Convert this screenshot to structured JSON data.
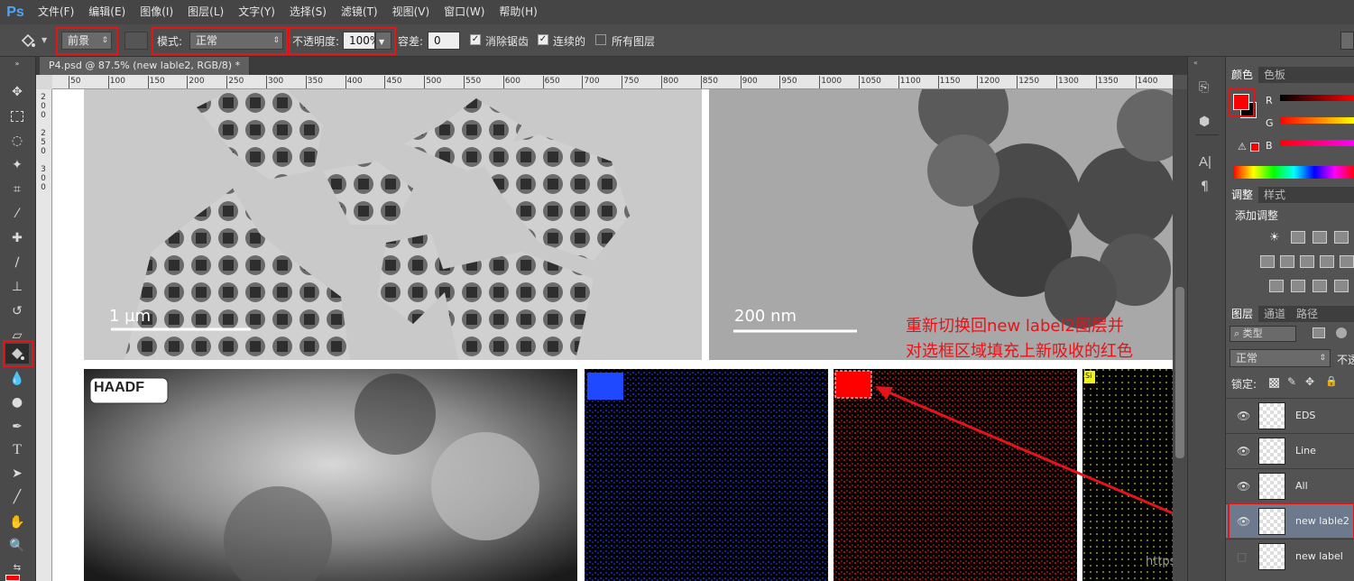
{
  "app": {
    "logo": "Ps"
  },
  "menu": [
    "文件(F)",
    "编辑(E)",
    "图像(I)",
    "图层(L)",
    "文字(Y)",
    "选择(S)",
    "滤镜(T)",
    "视图(V)",
    "窗口(W)",
    "帮助(H)"
  ],
  "options": {
    "fill_source": "前景",
    "mode_label": "模式:",
    "mode_value": "正常",
    "opacity_label": "不透明度:",
    "opacity_value": "100%",
    "tolerance_label": "容差:",
    "tolerance_value": "0",
    "antialias_label": "消除锯齿",
    "contiguous_label": "连续的",
    "all_layers_label": "所有图层"
  },
  "document": {
    "tab_title": "P4.psd @ 87.5% (new lable2, RGB/8) *"
  },
  "ruler_h": [
    "50",
    "100",
    "150",
    "200",
    "250",
    "300",
    "350",
    "400",
    "450",
    "500",
    "550",
    "600",
    "650",
    "700",
    "750",
    "800",
    "850",
    "900",
    "950",
    "1000",
    "1050",
    "1100",
    "1150",
    "1200",
    "1250",
    "1300",
    "1350",
    "1400"
  ],
  "canvas": {
    "scale_left": "1 µm",
    "scale_right": "200 nm",
    "haadf_label": "HAADF",
    "yellow_tag": "Si",
    "annotation_line1": "重新切换回new label2图层并",
    "annotation_line2": "对选框区域填充上新吸收的红色"
  },
  "panels": {
    "color_tabs": [
      "颜色",
      "色板"
    ],
    "color_channels": [
      "R",
      "G",
      "B"
    ],
    "adjust_tabs": [
      "调整",
      "样式"
    ],
    "adjust_title": "添加调整",
    "layer_tabs": [
      "图层",
      "通道",
      "路径"
    ],
    "filter_kind": "类型",
    "blend_mode": "正常",
    "opacity_short": "不透",
    "lock_label": "锁定:"
  },
  "layers": [
    {
      "name": "EDS",
      "selected": false
    },
    {
      "name": "Line",
      "selected": false
    },
    {
      "name": "All",
      "selected": false
    },
    {
      "name": "new lable2",
      "selected": true
    },
    {
      "name": "new label",
      "selected": false
    }
  ],
  "colors": {
    "foreground": "#ff0000",
    "accent": "#e3151b"
  },
  "watermark": "https://blog.csdn.net/XD_Yangf"
}
